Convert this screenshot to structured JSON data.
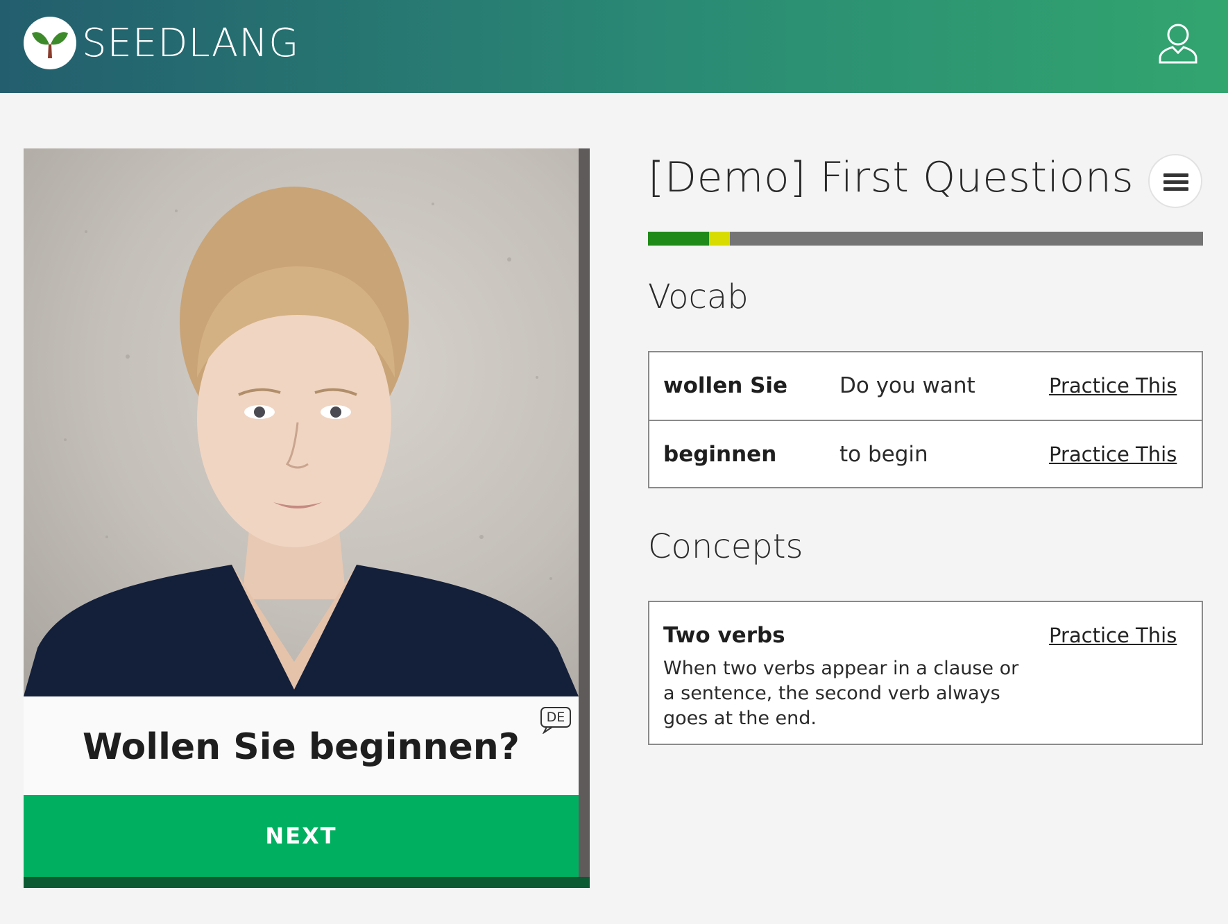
{
  "app": {
    "brand": "SEEDLANG",
    "logo_icon": "seedling-icon",
    "user_icon": "user-icon",
    "header_gradient": [
      "#235e6e",
      "#32a56f"
    ]
  },
  "card": {
    "video_icon": "video-still",
    "phrase": "Wollen Sie beginnen?",
    "language_badge": "DE",
    "next_label": "NEXT",
    "next_color": "#00b060"
  },
  "deck": {
    "title": "[Demo] First Questions",
    "menu_icon": "hamburger-menu-icon",
    "progress": {
      "known_fraction": 0.11,
      "learning_fraction": 0.037,
      "known_color": "#1f8a18",
      "learning_color": "#d8dc00",
      "remaining_color": "#747474"
    }
  },
  "vocab": {
    "heading": "Vocab",
    "items": [
      {
        "word": "wollen Sie",
        "meaning": "Do you want",
        "action": "Practice This"
      },
      {
        "word": "beginnen",
        "meaning": "to begin",
        "action": "Practice This"
      }
    ]
  },
  "concepts": {
    "heading": "Concepts",
    "items": [
      {
        "title": "Two verbs",
        "description": "When two verbs appear in a clause or a sentence, the second verb always goes at the end.",
        "action": "Practice This"
      }
    ]
  }
}
